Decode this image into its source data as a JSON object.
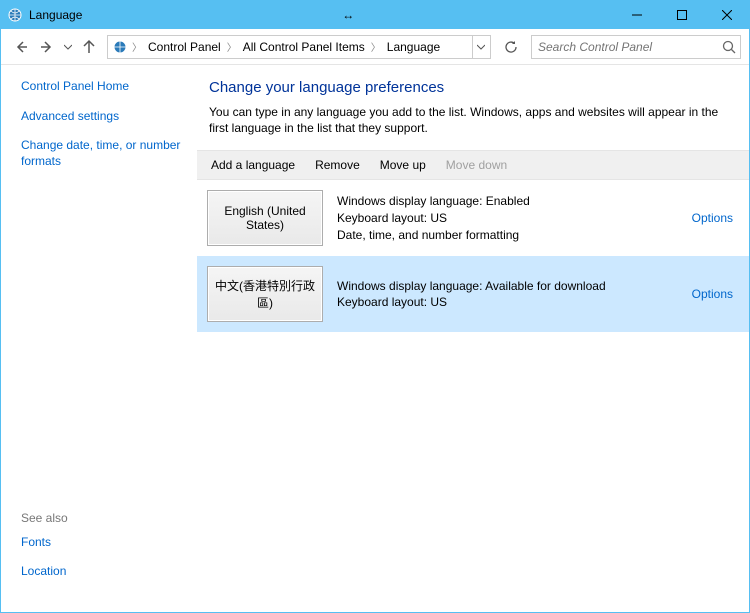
{
  "window": {
    "title": "Language"
  },
  "breadcrumbs": {
    "items": [
      "Control Panel",
      "All Control Panel Items",
      "Language"
    ]
  },
  "search": {
    "placeholder": "Search Control Panel"
  },
  "sidebar": {
    "home": "Control Panel Home",
    "links": [
      "Advanced settings",
      "Change date, time, or number formats"
    ],
    "seealso_label": "See also",
    "seealso": [
      "Fonts",
      "Location"
    ]
  },
  "main": {
    "heading": "Change your language preferences",
    "description": "You can type in any language you add to the list. Windows, apps and websites will appear in the first language in the list that they support."
  },
  "toolbar": {
    "add": "Add a language",
    "remove": "Remove",
    "moveup": "Move up",
    "movedown": "Move down"
  },
  "languages": [
    {
      "tile": "English (United States)",
      "line1": "Windows display language: Enabled",
      "line2": "Keyboard layout: US",
      "line3": "Date, time, and number formatting",
      "options": "Options",
      "selected": false
    },
    {
      "tile": "中文(香港特別行政區)",
      "line1": "Windows display language: Available for download",
      "line2": "Keyboard layout: US",
      "line3": "",
      "options": "Options",
      "selected": true
    }
  ]
}
